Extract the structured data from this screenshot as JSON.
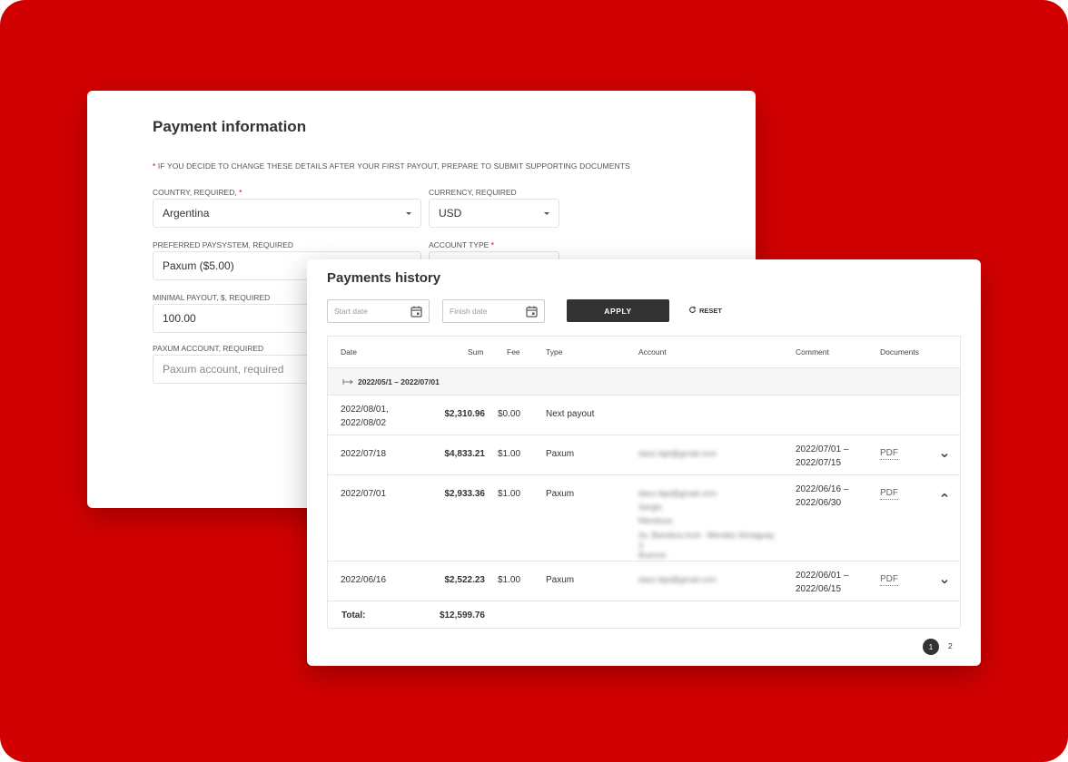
{
  "payment_info": {
    "title": "Payment information",
    "notice_star": "*",
    "notice": "IF YOU DECIDE TO CHANGE THESE DETAILS AFTER YOUR FIRST PAYOUT, PREPARE TO SUBMIT SUPPORTING DOCUMENTS",
    "country_label": "COUNTRY, REQUIRED,",
    "country_star": "*",
    "country_value": "Argentina",
    "currency_label": "CURRENCY, REQUIRED",
    "currency_value": "USD",
    "paysystem_label": "PREFERRED PAYSYSTEM, REQUIRED",
    "paysystem_value": "Paxum ($5.00)",
    "account_type_label": "ACCOUNT TYPE",
    "account_type_star": "*",
    "min_payout_label": "MINIMAL PAYOUT, $, REQUIRED",
    "min_payout_value": "100.00",
    "paxum_account_label": "PAXUM ACCOUNT, REQUIRED",
    "paxum_account_placeholder": "Paxum account, required"
  },
  "history": {
    "title": "Payments history",
    "start_date_placeholder": "Start date",
    "finish_date_placeholder": "Finish date",
    "apply_label": "APPLY",
    "reset_label": "RESET",
    "columns": {
      "date": "Date",
      "sum": "Sum",
      "fee": "Fee",
      "type": "Type",
      "account": "Account",
      "comment": "Comment",
      "documents": "Documents"
    },
    "group_range": "2022/05/1 – 2022/07/01",
    "rows": [
      {
        "date1": "2022/08/01,",
        "date2": "2022/08/02",
        "sum": "$2,310.96",
        "fee": "$0.00",
        "type": "Next payout"
      },
      {
        "date1": "2022/07/18",
        "sum": "$4,833.21",
        "fee": "$1.00",
        "type": "Paxum",
        "account": "dasz.fapi@gmail.com",
        "comment1": "2022/07/01 –",
        "comment2": "2022/07/15",
        "doc": "PDF"
      },
      {
        "date1": "2022/07/01",
        "sum": "$2,933.36",
        "fee": "$1.00",
        "type": "Paxum",
        "account": "dasz.fapi@gmail.com",
        "account2": "Sergio",
        "account3": "Mendoza",
        "account4": "Av. Bandera Invit - Mendez Almaguay 3",
        "account5": "Buenos",
        "comment1": "2022/06/16 –",
        "comment2": "2022/06/30",
        "doc": "PDF"
      },
      {
        "date1": "2022/06/16",
        "sum": "$2,522.23",
        "fee": "$1.00",
        "type": "Paxum",
        "account": "dasz.fapi@gmail.com",
        "comment1": "2022/06/01 –",
        "comment2": "2022/06/15",
        "doc": "PDF"
      }
    ],
    "total_label": "Total:",
    "total_value": "$12,599.76",
    "pages": [
      "1",
      "2"
    ]
  }
}
